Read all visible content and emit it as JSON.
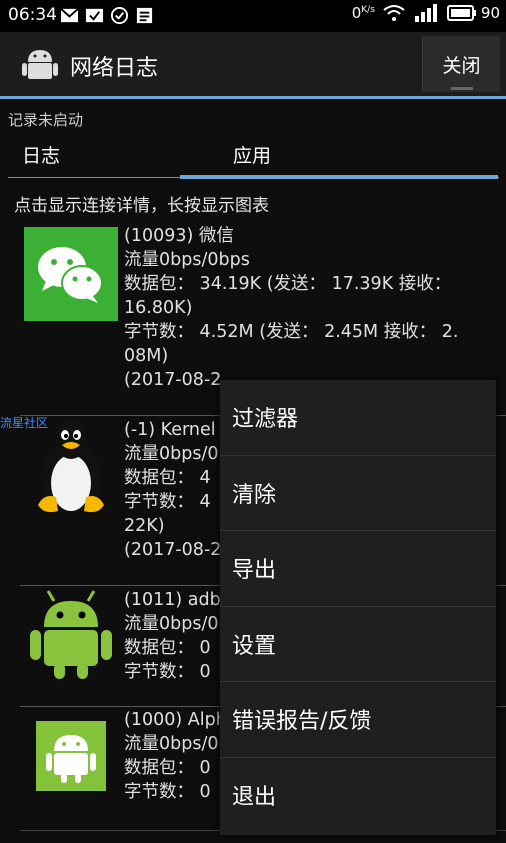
{
  "status_bar": {
    "time": "06:34",
    "speed": "0",
    "speed_unit": "K/s",
    "battery": "90"
  },
  "action_bar": {
    "title": "网络日志",
    "close_label": "关闭"
  },
  "record_status": "记录未启动",
  "tabs": [
    {
      "label": "日志"
    },
    {
      "label": "应用"
    }
  ],
  "hint": "点击显示连接详情，长按显示图表",
  "apps": [
    {
      "name": "(10093) 微信",
      "icon": "wechat-icon",
      "lines": [
        "流量0bps/0bps",
        "数据包： 34.19K (发送： 17.39K 接收：",
        "16.80K)",
        "字节数： 4.52M (发送： 2.45M 接收： 2.",
        "08M)",
        "(2017-08-2"
      ]
    },
    {
      "name": "(-1) Kernel",
      "icon": "linux-tux-icon",
      "lines": [
        "流量0bps/0",
        "数据包： 4",
        "字节数： 4",
        "22K)",
        "(2017-08-2"
      ]
    },
    {
      "name": "(1011) adb",
      "icon": "android-robot-icon",
      "lines": [
        "流量0bps/0",
        "数据包： 0",
        "字节数： 0"
      ]
    },
    {
      "name": "(1000) Alph",
      "icon": "android-green-box-icon",
      "lines": [
        "流量0bps/0",
        "数据包： 0",
        "字节数： 0"
      ]
    }
  ],
  "watermark": "流星社区",
  "menu": {
    "items": [
      {
        "label": "过滤器"
      },
      {
        "label": "清除"
      },
      {
        "label": "导出"
      },
      {
        "label": "设置"
      },
      {
        "label": "错误报告/反馈"
      },
      {
        "label": "退出"
      }
    ]
  }
}
